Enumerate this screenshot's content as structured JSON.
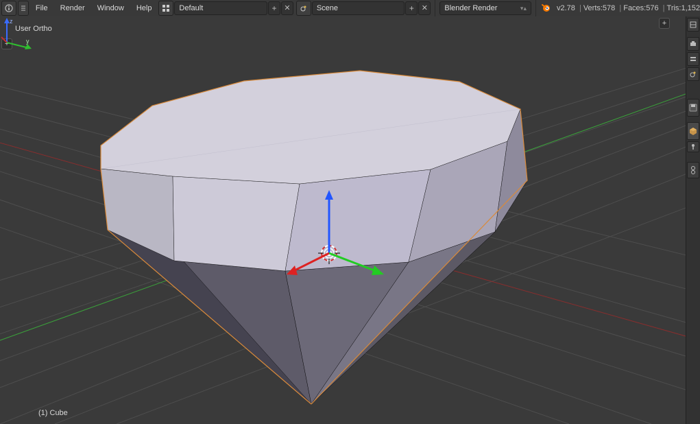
{
  "menu": {
    "file": "File",
    "render": "Render",
    "window": "Window",
    "help": "Help"
  },
  "layout_field": "Default",
  "scene_field": "Scene",
  "engine_field": "Blender Render",
  "version": "v2.78",
  "stats": {
    "verts": "Verts:578",
    "faces": "Faces:576",
    "tris": "Tris:1,152"
  },
  "view_label": "User Ortho",
  "object_label": "(1) Cube",
  "corner_axis": {
    "z": "z",
    "y": "y"
  }
}
